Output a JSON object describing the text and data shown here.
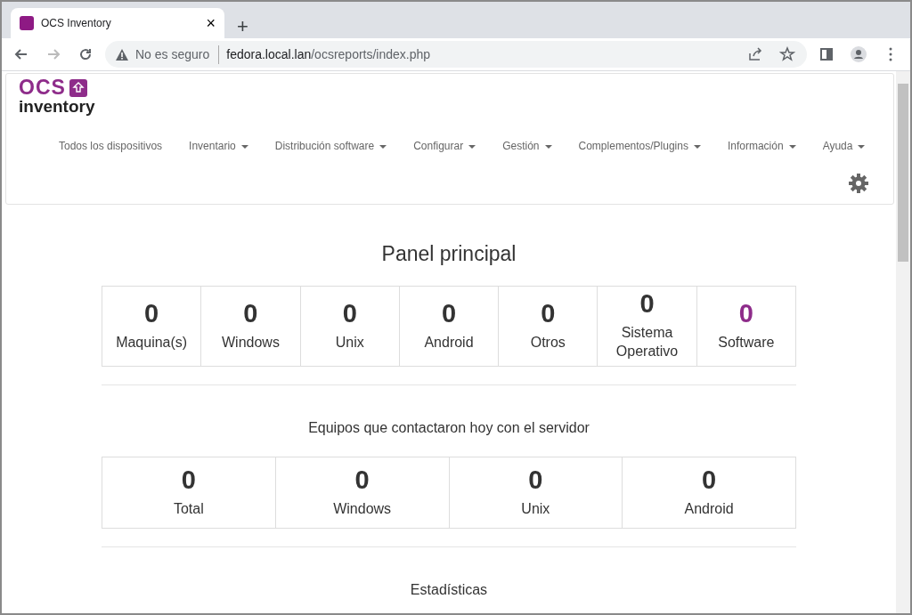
{
  "browser": {
    "tab": {
      "title": "OCS Inventory",
      "close": "×"
    },
    "new_tab": "+",
    "security_warning": "No es seguro",
    "url_host": "fedora.local.lan",
    "url_path": "/ocsreports/index.php"
  },
  "logo": {
    "top": "OCS",
    "bottom": "inventory"
  },
  "nav": [
    {
      "label": "Todos los dispositivos",
      "dropdown": false
    },
    {
      "label": "Inventario",
      "dropdown": true
    },
    {
      "label": "Distribución software",
      "dropdown": true
    },
    {
      "label": "Configurar",
      "dropdown": true
    },
    {
      "label": "Gestión",
      "dropdown": true
    },
    {
      "label": "Complementos/Plugins",
      "dropdown": true
    },
    {
      "label": "Información",
      "dropdown": true
    },
    {
      "label": "Ayuda",
      "dropdown": true
    }
  ],
  "sections": [
    {
      "title": "Panel principal",
      "kind": "main",
      "stats": [
        {
          "value": "0",
          "label": "Maquina(s)",
          "highlighted": false
        },
        {
          "value": "0",
          "label": "Windows",
          "highlighted": false
        },
        {
          "value": "0",
          "label": "Unix",
          "highlighted": false
        },
        {
          "value": "0",
          "label": "Android",
          "highlighted": false
        },
        {
          "value": "0",
          "label": "Otros",
          "highlighted": false
        },
        {
          "value": "0",
          "label": "Sistema Operativo",
          "highlighted": false
        },
        {
          "value": "0",
          "label": "Software",
          "highlighted": true
        }
      ]
    },
    {
      "title": "Equipos que contactaron hoy con el servidor",
      "kind": "sub",
      "stats": [
        {
          "value": "0",
          "label": "Total",
          "highlighted": false
        },
        {
          "value": "0",
          "label": "Windows",
          "highlighted": false
        },
        {
          "value": "0",
          "label": "Unix",
          "highlighted": false
        },
        {
          "value": "0",
          "label": "Android",
          "highlighted": false
        }
      ]
    },
    {
      "title": "Estadísticas",
      "kind": "sub"
    }
  ]
}
